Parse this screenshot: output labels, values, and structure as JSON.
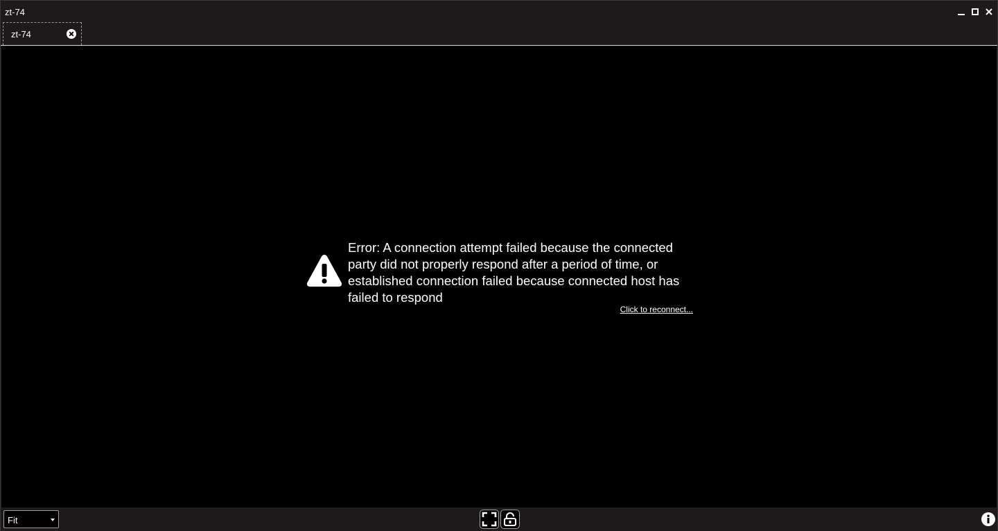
{
  "window": {
    "title": "zt-74",
    "controls": [
      "minimize-icon",
      "maximize-icon",
      "close-icon"
    ]
  },
  "tabs": [
    {
      "label": "zt-74",
      "close_icon": "close-circle-icon"
    }
  ],
  "viewport": {
    "error_message": "Error: A connection attempt failed because the connected party did not properly respond after a period of time, or established connection failed because connected host has failed to respond",
    "error_icon": "warning-icon",
    "reconnect_link": "Click to reconnect..."
  },
  "bottombar": {
    "scale_select": {
      "selected": "Fit"
    },
    "fullscreen_icon": "fullscreen-icon",
    "lock_icon": "unlock-icon",
    "info_icon": "info-icon"
  },
  "colors": {
    "chrome_bg": "#1e191a",
    "viewport_bg": "#000000",
    "text": "#ffffff"
  }
}
